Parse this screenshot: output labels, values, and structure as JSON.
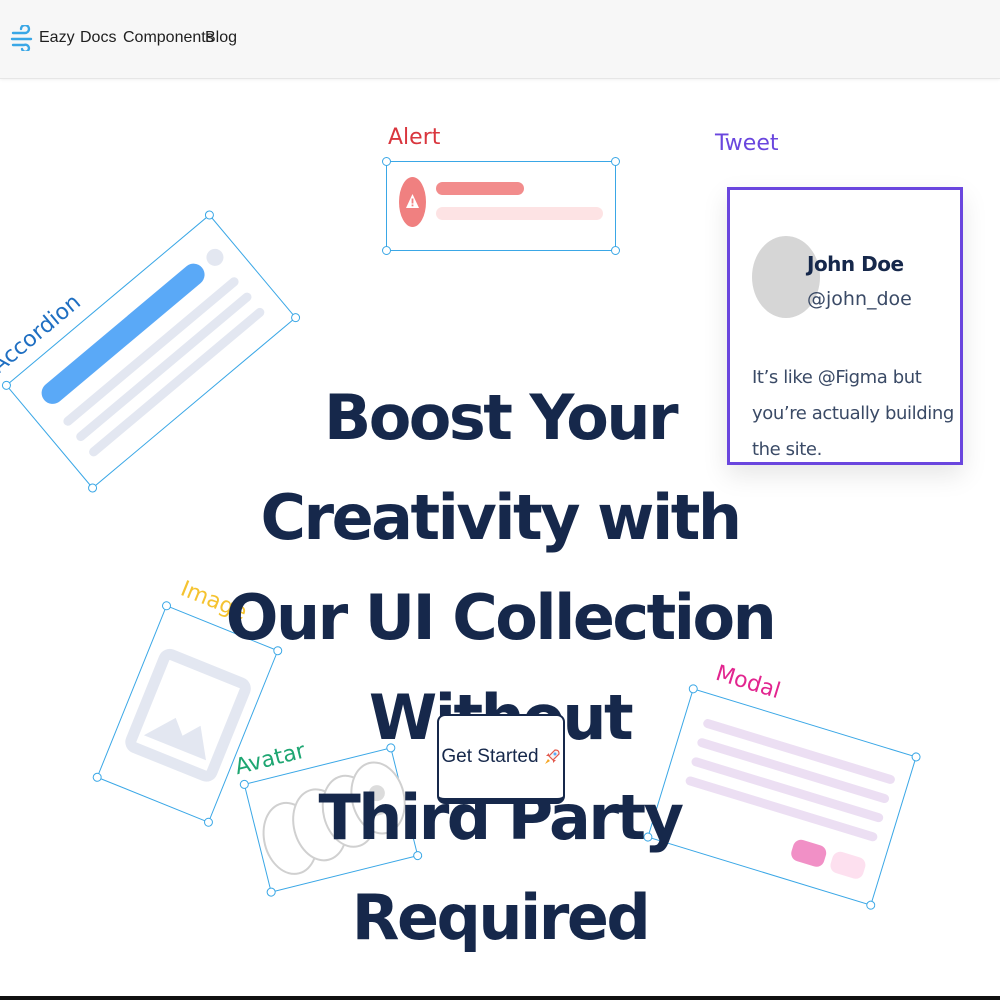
{
  "nav": {
    "logo_icon": "wind-logo-icon",
    "links": [
      "Eazy",
      "Docs",
      "Components",
      "Blog"
    ]
  },
  "hero": {
    "lines": [
      "Boost Your Creativity with",
      "Our UI Collection Without",
      "Third Party Required"
    ],
    "cta_label": "Get Started",
    "cta_icon": "rocket-icon"
  },
  "cards": {
    "accordion": {
      "label": "Accordion",
      "color": "#1f6fc2"
    },
    "alert": {
      "label": "Alert",
      "color": "#d9363e"
    },
    "tweet": {
      "label": "Tweet",
      "color": "#6a46de",
      "name": "John Doe",
      "handle": "@john_doe",
      "text": "It’s like @Figma but you’re actually building the site."
    },
    "image": {
      "label": "Image",
      "color": "#f5c330"
    },
    "avatar": {
      "label": "Avatar",
      "color": "#1ea672"
    },
    "modal": {
      "label": "Modal",
      "color": "#e2258f"
    }
  },
  "colors": {
    "primary": "#16284b",
    "selection": "#3aa7e6",
    "accordion_bar": "#5aa9f7",
    "placeholder": "#e3e7f1"
  }
}
